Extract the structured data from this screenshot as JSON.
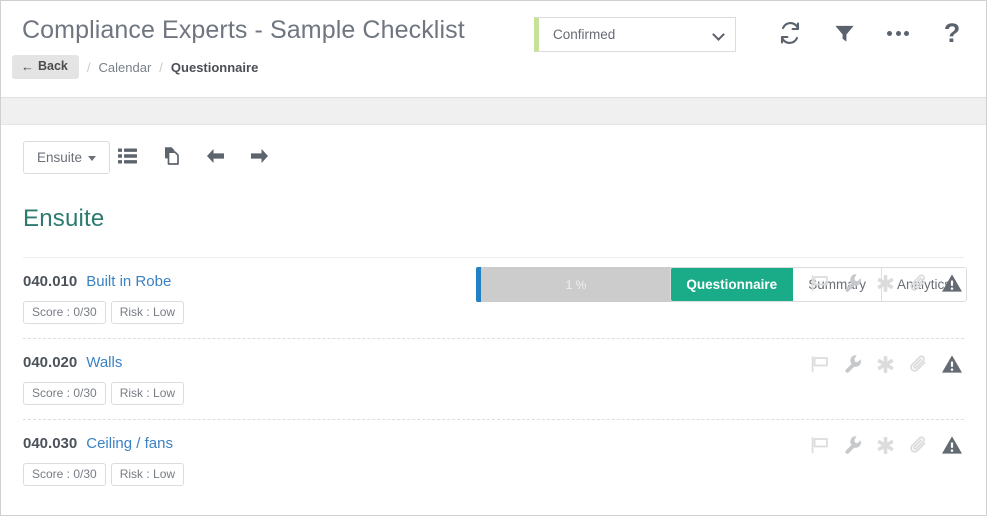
{
  "header": {
    "title": "Compliance Experts - Sample Checklist",
    "back_label": "Back",
    "back_arrow": "←",
    "breadcrumb": {
      "separator": "/",
      "parent": "Calendar",
      "current": "Questionnaire"
    },
    "status_select": {
      "value": "Confirmed",
      "accent_color": "#c6e29a",
      "options": [
        "Confirmed"
      ]
    },
    "icons": [
      {
        "name": "refresh-icon",
        "title": "Refresh"
      },
      {
        "name": "filter-icon",
        "title": "Filter"
      },
      {
        "name": "more-options-icon",
        "title": "More"
      },
      {
        "name": "help-icon",
        "title": "Help",
        "glyph": "?"
      }
    ]
  },
  "toolbar": {
    "dropdown_label": "Ensuite",
    "icons": [
      {
        "name": "list-view-icon",
        "title": "List view"
      },
      {
        "name": "copy-icon",
        "title": "Copy"
      },
      {
        "name": "previous-arrow-icon",
        "title": "Previous",
        "glyph": "←"
      },
      {
        "name": "next-arrow-icon",
        "title": "Next",
        "glyph": "→"
      }
    ],
    "progress": {
      "label": "1 %",
      "percent": 1,
      "fill_color": "#2380c4",
      "track_color": "#cccccc"
    },
    "tabs": [
      {
        "label": "Questionnaire",
        "active": true
      },
      {
        "label": "Summary",
        "active": false
      },
      {
        "label": "Analytics",
        "active": false
      }
    ],
    "active_tab_color": "#1aab88"
  },
  "section": {
    "title": "Ensuite",
    "title_color": "#2d7b70"
  },
  "items": [
    {
      "code": "040.010",
      "title": "Built in Robe",
      "score_badge": "Score : 0/30",
      "risk_badge": "Risk : Low"
    },
    {
      "code": "040.020",
      "title": "Walls",
      "score_badge": "Score : 0/30",
      "risk_badge": "Risk : Low"
    },
    {
      "code": "040.030",
      "title": "Ceiling / fans",
      "score_badge": "Score : 0/30",
      "risk_badge": "Risk : Low"
    }
  ],
  "row_icons": [
    {
      "name": "flag-icon",
      "title": "Flag"
    },
    {
      "name": "wrench-icon",
      "title": "Maintenance"
    },
    {
      "name": "asterisk-icon",
      "title": "Required"
    },
    {
      "name": "paperclip-icon",
      "title": "Attachment"
    },
    {
      "name": "warning-icon",
      "title": "Warning"
    }
  ]
}
